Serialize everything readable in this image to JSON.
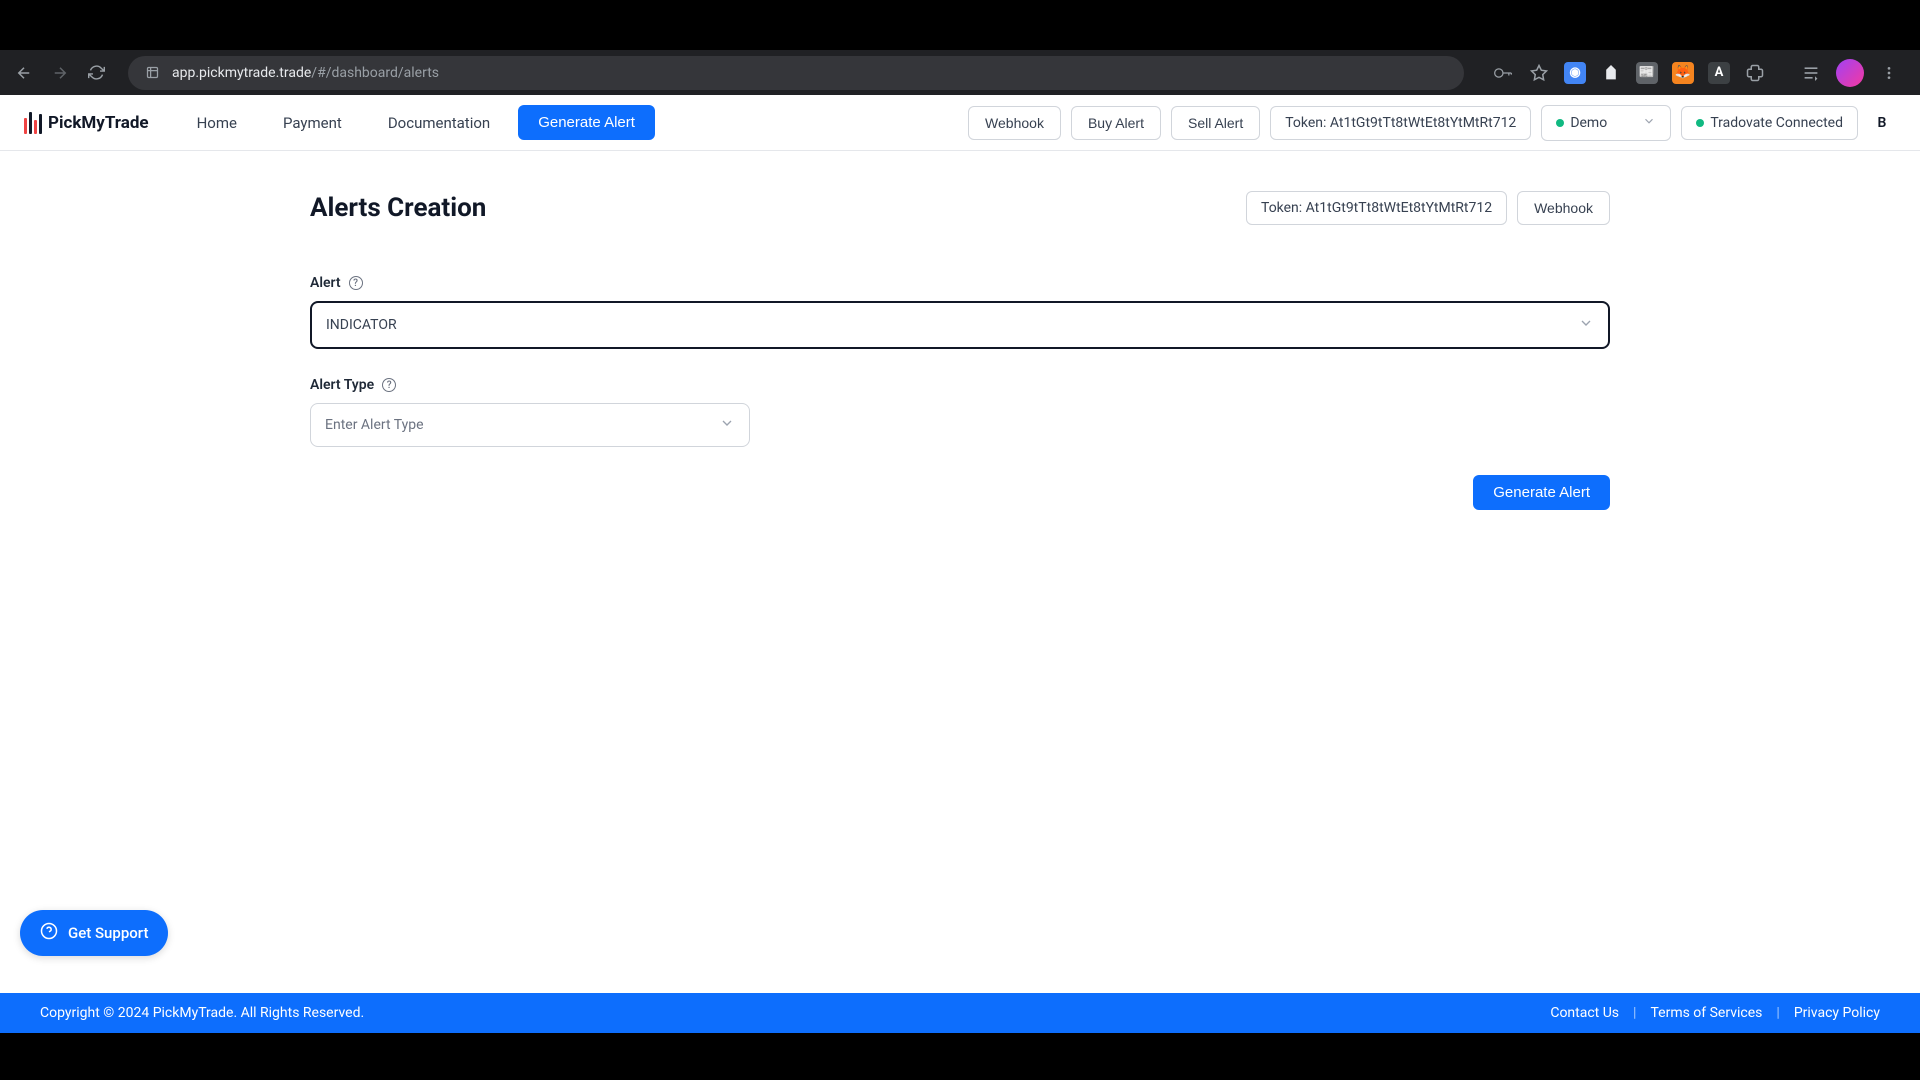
{
  "browser": {
    "url_domain": "app.pickmytrade.trade",
    "url_path": "/#/dashboard/alerts"
  },
  "header": {
    "logo_text": "PickMyTrade",
    "nav": {
      "home": "Home",
      "payment": "Payment",
      "documentation": "Documentation",
      "generate_alert": "Generate Alert"
    },
    "webhook": "Webhook",
    "buy_alert": "Buy Alert",
    "sell_alert": "Sell Alert",
    "token_label": "Token: At1tGt9tTt8tWtEt8tYtMtRt712",
    "account": "Demo",
    "connection": "Tradovate Connected",
    "user_initial": "B"
  },
  "page": {
    "title": "Alerts Creation",
    "header_token": "Token: At1tGt9tTt8tWtEt8tYtMtRt712",
    "header_webhook": "Webhook",
    "alert_label": "Alert",
    "alert_value": "INDICATOR",
    "alert_type_label": "Alert Type",
    "alert_type_placeholder": "Enter Alert Type",
    "generate_button": "Generate Alert"
  },
  "support_button": "Get Support",
  "footer": {
    "copyright": "Copyright © 2024 PickMyTrade. All Rights Reserved.",
    "contact": "Contact Us",
    "terms": "Terms of Services",
    "privacy": "Privacy Policy"
  }
}
